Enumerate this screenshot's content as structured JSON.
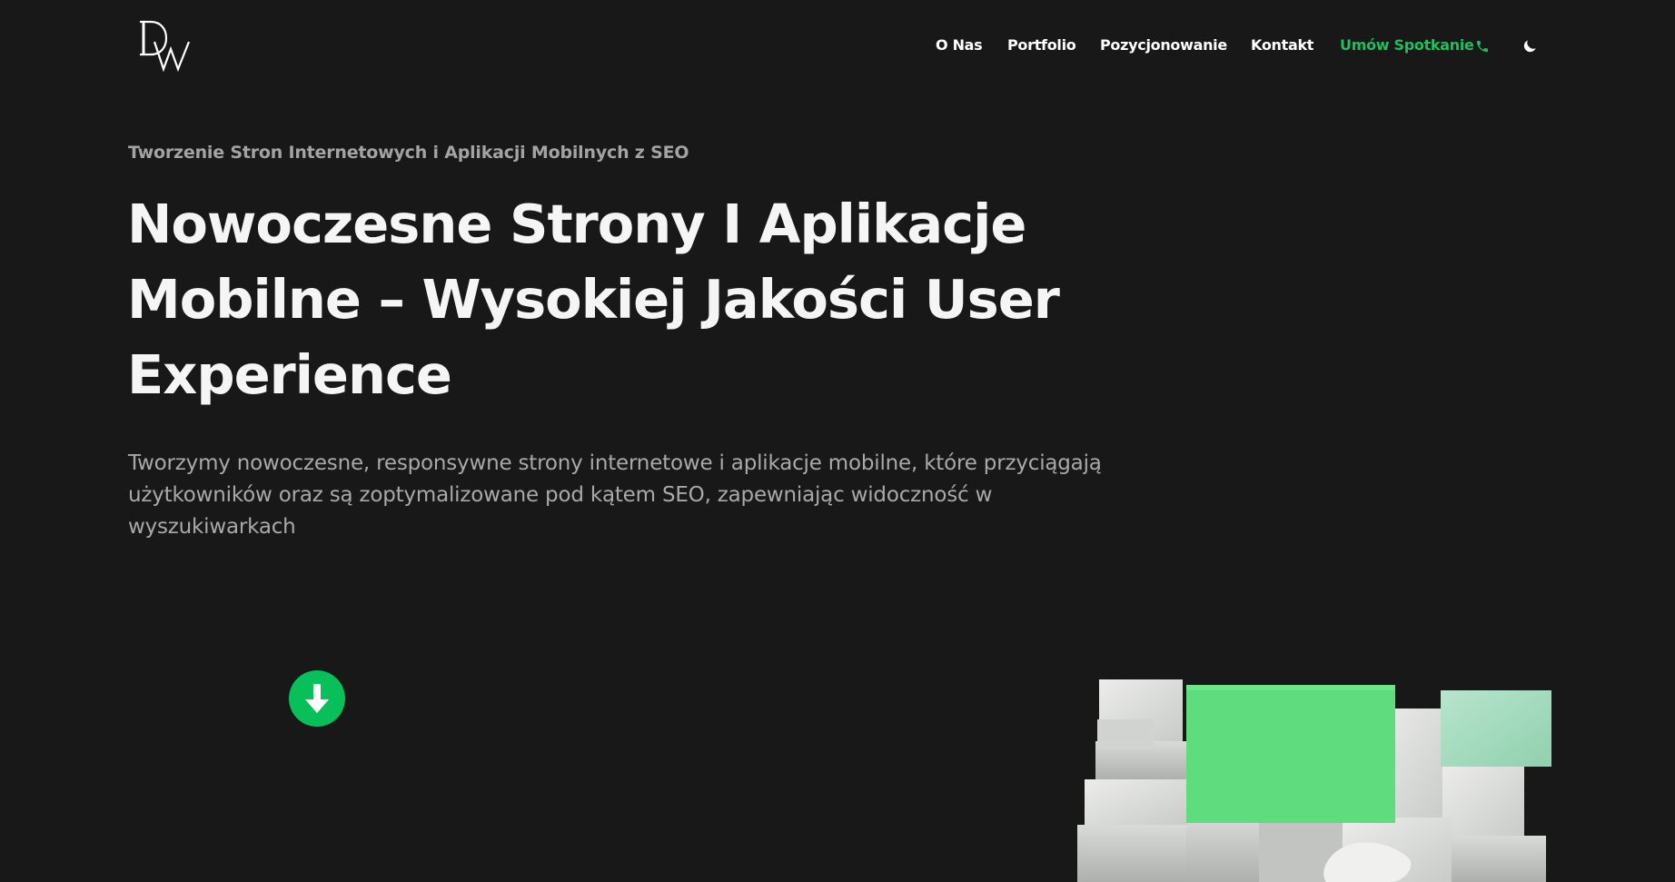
{
  "header": {
    "logo_text": "DW",
    "nav": {
      "items": [
        {
          "label": "O Nas"
        },
        {
          "label": "Portfolio"
        },
        {
          "label": "Pozycjonowanie"
        },
        {
          "label": "Kontakt"
        }
      ],
      "cta_label": "Umów Spotkanie",
      "cta_icon": "phone-icon",
      "theme_icon": "moon-icon"
    }
  },
  "hero": {
    "eyebrow": "Tworzenie Stron Internetowych i Aplikacji Mobilnych z SEO",
    "headline": "Nowoczesne Strony I Aplikacje Mobilne – Wysokiej Jakości User Experience",
    "description": "Tworzymy nowoczesne, responsywne strony internetowe i aplikacje mobilne, które przyciągają użytkowników oraz są zoptymalizowane pod kątem SEO, zapewniając widoczność w wyszukiwarkach",
    "scroll_icon": "arrow-down-icon",
    "art_icon": "stacked-blocks-illustration"
  },
  "colors": {
    "background": "#181818",
    "text": "#f5f5f5",
    "muted": "#a9a9a9",
    "accent": "#08c05a"
  }
}
